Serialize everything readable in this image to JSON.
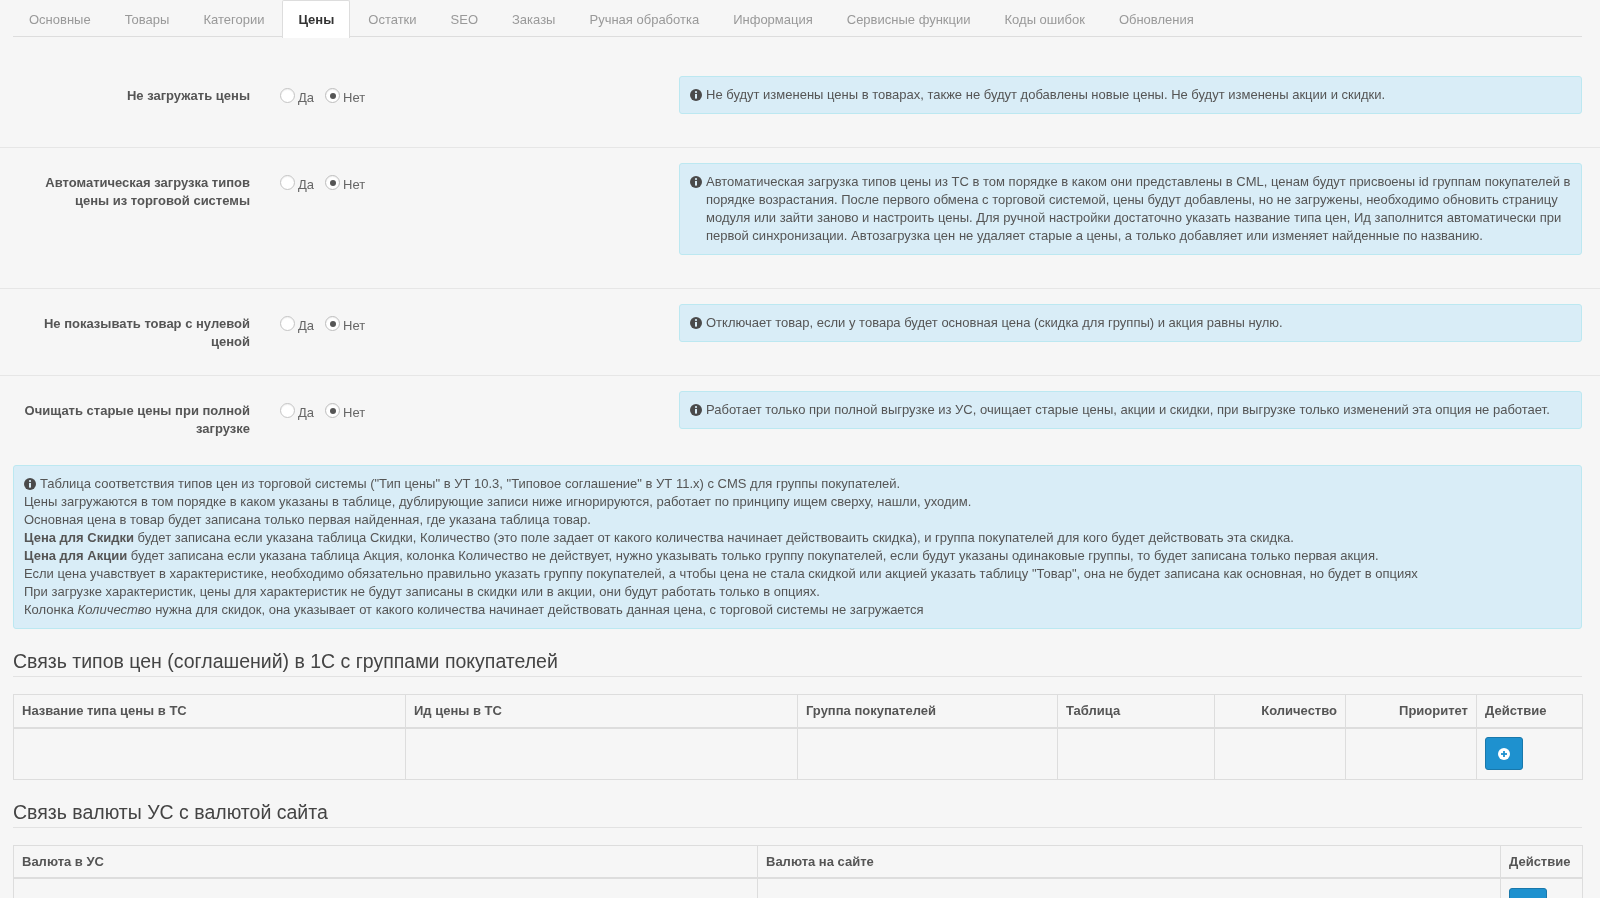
{
  "tabs": [
    {
      "label": "Основные",
      "selected": false
    },
    {
      "label": "Товары",
      "selected": false
    },
    {
      "label": "Категории",
      "selected": false
    },
    {
      "label": "Цены",
      "selected": true
    },
    {
      "label": "Остатки",
      "selected": false
    },
    {
      "label": "SEO",
      "selected": false
    },
    {
      "label": "Заказы",
      "selected": false
    },
    {
      "label": "Ручная обработка",
      "selected": false
    },
    {
      "label": "Информация",
      "selected": false
    },
    {
      "label": "Сервисные функции",
      "selected": false
    },
    {
      "label": "Коды ошибок",
      "selected": false
    },
    {
      "label": "Обновления",
      "selected": false
    }
  ],
  "settings": [
    {
      "label": "Не загружать цены",
      "options": [
        {
          "label": "Да",
          "selected": false
        },
        {
          "label": "Нет",
          "selected": true
        }
      ],
      "info": "Не будут изменены цены в товарах, также не будут добавлены новые цены. Не будут изменены акции и скидки."
    },
    {
      "label": "Автоматическая загрузка типов цены из торговой системы",
      "options": [
        {
          "label": "Да",
          "selected": false
        },
        {
          "label": "Нет",
          "selected": true
        }
      ],
      "info": "Автоматическая загрузка типов цены из ТС в том порядке в каком они представлены в CML, ценам будут присвоены id группам покупателей в порядке возрастания. После первого обмена с торговой системой, цены будут добавлены, но не загружены, необходимо обновить страницу модуля или зайти заново и настроить цены. Для ручной настройки достаточно указать название типа цен, Ид заполнится автоматически при первой синхронизации. Автозагрузка цен не удаляет старые а цены, а только добавляет или изменяет найденные по названию."
    },
    {
      "label": "Не показывать товар с нулевой ценой",
      "options": [
        {
          "label": "Да",
          "selected": false
        },
        {
          "label": "Нет",
          "selected": true
        }
      ],
      "info": "Отключает товар, если у товара будет основная цена (скидка для группы) и акция равны нулю."
    },
    {
      "label": "Очищать старые цены при полной загрузке",
      "options": [
        {
          "label": "Да",
          "selected": false
        },
        {
          "label": "Нет",
          "selected": true
        }
      ],
      "info": "Работает только при полной выгрузке из УС, очищает старые цены, акции и скидки, при выгрузке только изменений эта опция не работает."
    }
  ],
  "notice": {
    "lines": [
      "Таблица соответствия типов цен из торговой системы (\"Тип цены\" в УТ 10.3, \"Типовое соглашение\" в УТ 11.x) с CMS для группы покупателей.",
      "Цены загружаются в том порядке в каком указаны в таблице, дублирующие записи ниже игнорируются, работает по принципу ищем сверху, нашли, уходим.",
      "Основная цена в товар будет записана только первая найденная, где указана таблица товар.",
      "**Цена для Скидки** будет записана если указана таблица Скидки, Количество (это поле задает от какого количества начинает действоваить скидка), и группа покупателей для кого будет действовать эта скидка.",
      "**Цена для Акции** будет записана если указана таблица Акция, колонка Количество не действует, нужно указывать только группу покупателей, если будут указаны одинаковые группы, то будет записана только первая акция.",
      "Если цена учавствует в характеристике, необходимо обязательно правильно указать группу покупателей, а чтобы цена не стала скидкой или акцией указать таблицу \"Товар\", она не будет записана как основная, но будет в опциях",
      "При загрузке характеристик, цены для характеристик не будут записаны в скидки или в акции, они будут работать только в опциях.",
      "Колонка *Количество* нужна для скидок, она указывает от какого количества начинает действовать данная цена, с торговой системы не загружается"
    ]
  },
  "tables": [
    {
      "title": "Связь типов цен (соглашений) в 1С с группами покупателей",
      "columns": [
        "Название типа цены в ТС",
        "Ид цены в ТС",
        "Группа покупателей",
        "Таблица",
        "Количество",
        "Приоритет",
        "Действие"
      ]
    },
    {
      "title": "Связь валюты УС с валютой сайта",
      "columns": [
        "Валюта в УС",
        "Валюта на сайте",
        "Действие"
      ]
    }
  ]
}
